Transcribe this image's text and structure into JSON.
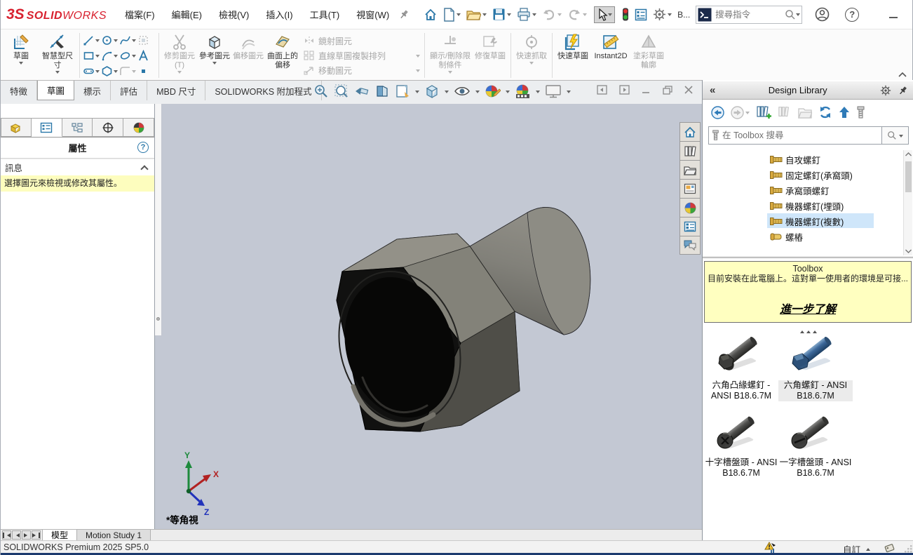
{
  "titlebar": {
    "logo_prefix": "3S",
    "logo_solid": "SOLID",
    "logo_works": "WORKS",
    "menus": [
      "檔案(F)",
      "編輯(E)",
      "檢視(V)",
      "插入(I)",
      "工具(T)",
      "視窗(W)"
    ],
    "doc_short": "B...",
    "search_placeholder": "搜尋指令"
  },
  "ribbon": {
    "sketch": "草圖",
    "smart_dimension": "智慧型尺寸",
    "trim": "修剪圖元(T)",
    "convert": "參考圖元",
    "offset": "偏移圖元",
    "offset_on_surface": "曲面上的偏移",
    "mirror": "鏡射圖元",
    "linear_pattern": "直線草圖複製排列",
    "move": "移動圖元",
    "display_delete_relations": "顯示/刪除限制條件",
    "repair_sketch": "修復草圖",
    "quick_snaps": "快速抓取",
    "rapid_sketch": "快速草圖",
    "instant2d": "Instant2D",
    "shaded_sketch_contours": "塗彩草圖輪廓",
    "tabs": [
      "特徵",
      "草圖",
      "標示",
      "評估",
      "MBD 尺寸",
      "SOLIDWORKS 附加程式"
    ]
  },
  "property_panel": {
    "title": "屬性",
    "section": "訊息",
    "message": "選擇圖元來檢視或修改其屬性。"
  },
  "viewport": {
    "view_label": "*等角視",
    "axis_x": "X",
    "axis_y": "Y",
    "axis_z": "Z"
  },
  "task_pane": {
    "collapse_icon": "«",
    "title": "Design Library",
    "search_placeholder": "在 Toolbox 搜尋",
    "tree": [
      {
        "label": "自攻螺釘"
      },
      {
        "label": "固定螺釘(承窩頭)"
      },
      {
        "label": "承窩頭螺釘"
      },
      {
        "label": "機器螺釘(埋頭)"
      },
      {
        "label": "機器螺釘(複數)"
      },
      {
        "label": "螺樁"
      }
    ],
    "notice": {
      "title": "Toolbox",
      "body": "目前安裝在此電腦上。這對單一使用者的環境是可接...",
      "link": "進一步了解"
    },
    "items": [
      {
        "label": "六角凸緣螺釘 - ANSI B18.6.7M"
      },
      {
        "label": "六角螺釘 - ANSI B18.6.7M"
      },
      {
        "label": "十字槽盤頭 - ANSI B18.6.7M"
      },
      {
        "label": "一字槽盤頭 - ANSI B18.6.7M"
      }
    ]
  },
  "bottom_bar": {
    "model_tab": "模型",
    "motion_tab": "Motion Study 1",
    "status": "SOLIDWORKS Premium 2025 SP5.0",
    "custom": "自訂"
  },
  "icons": {
    "help": "?"
  },
  "colors": {
    "viewport_bg": "#c3c8d3",
    "highlight_yellow": "#ffffc0",
    "selection_blue": "#cfe6fa",
    "logo_red": "#d8212f",
    "icon_blue": "#2a77a8",
    "taskbar_navy": "#1c3a6e"
  }
}
